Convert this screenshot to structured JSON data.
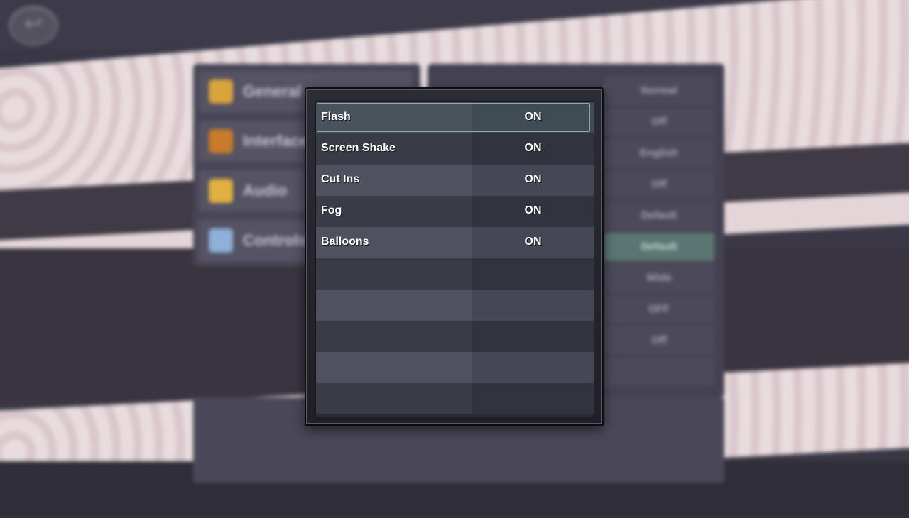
{
  "background": {
    "left_menu": [
      {
        "label": "General",
        "icon": "general-icon",
        "color": "#d9a43c",
        "active": true
      },
      {
        "label": "Interface",
        "icon": "interface-icon",
        "color": "#c97a2a",
        "active": false
      },
      {
        "label": "Audio",
        "icon": "audio-icon",
        "color": "#e0b040",
        "active": false
      },
      {
        "label": "Controls",
        "icon": "controls-icon",
        "color": "#8fb0d8",
        "active": false
      }
    ],
    "right_values": [
      "Normal",
      "Off",
      "English",
      "Off",
      "Default",
      "Default",
      "Wide",
      "OFF",
      "Off",
      ""
    ]
  },
  "dialog": {
    "rows": [
      {
        "label": "Flash",
        "value": "ON"
      },
      {
        "label": "Screen Shake",
        "value": "ON"
      },
      {
        "label": "Cut Ins",
        "value": "ON"
      },
      {
        "label": "Fog",
        "value": "ON"
      },
      {
        "label": "Balloons",
        "value": "ON"
      },
      {
        "label": "",
        "value": ""
      },
      {
        "label": "",
        "value": ""
      },
      {
        "label": "",
        "value": ""
      },
      {
        "label": "",
        "value": ""
      },
      {
        "label": "",
        "value": ""
      }
    ],
    "selected_index": 0
  },
  "colors": {
    "selection_border": "#8fa2ad",
    "row_light": "#50505e",
    "row_dark": "#3b3b48"
  }
}
